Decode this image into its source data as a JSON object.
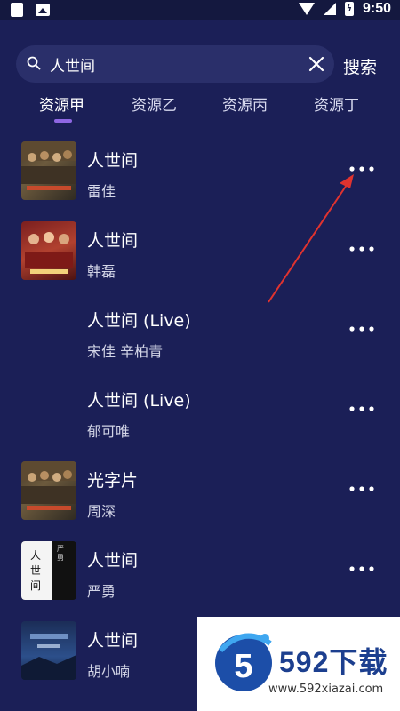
{
  "status_bar": {
    "time": "9:50"
  },
  "search": {
    "value": "人世间",
    "button_label": "搜索"
  },
  "tabs": [
    {
      "label": "资源甲",
      "active": true
    },
    {
      "label": "资源乙",
      "active": false
    },
    {
      "label": "资源丙",
      "active": false
    },
    {
      "label": "资源丁",
      "active": false
    }
  ],
  "songs": [
    {
      "title": "人世间",
      "artist": "雷佳",
      "cover": "drama-poster"
    },
    {
      "title": "人世间",
      "artist": "韩磊",
      "cover": "red-poster"
    },
    {
      "title": "人世间 (Live)",
      "artist": "宋佳 辛柏青",
      "cover": "none"
    },
    {
      "title": "人世间 (Live)",
      "artist": "郁可唯",
      "cover": "none"
    },
    {
      "title": "光字片",
      "artist": "周深",
      "cover": "drama-poster"
    },
    {
      "title": "人世间",
      "artist": "严勇",
      "cover": "black-white"
    },
    {
      "title": "人世间",
      "artist": "胡小喃",
      "cover": "blue"
    }
  ],
  "cover_texts": {
    "bw_main": "人世间",
    "bw_side": "严勇"
  },
  "watermark": {
    "brand": "592下载",
    "url": "www.592xiazai.com"
  },
  "colors": {
    "background": "#1b1f57",
    "accent": "#8f67e3",
    "arrow": "#e0332f"
  }
}
